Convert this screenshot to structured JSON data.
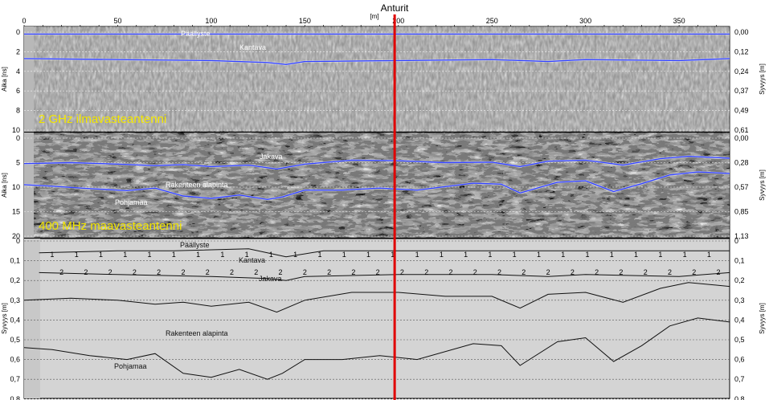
{
  "chart_data": {
    "type": "line",
    "title": "Anturit",
    "x": {
      "unit_label": "[m]",
      "range": [
        0,
        377
      ],
      "ticks": [
        0,
        50,
        100,
        150,
        200,
        250,
        300,
        350
      ],
      "marker": 198
    },
    "panels": [
      {
        "id": "ghz",
        "label": "2 GHz ilmavasteantenni",
        "left_axis": {
          "label": "Aika [ns]",
          "range": [
            0,
            10
          ],
          "ticks": [
            0,
            2,
            4,
            6,
            8,
            10
          ]
        },
        "right_axis": {
          "label": "Syvyys [m]",
          "ticks": [
            {
              "pos": 0,
              "text": "0,00"
            },
            {
              "pos": 2,
              "text": "0,12"
            },
            {
              "pos": 4,
              "text": "0,24"
            },
            {
              "pos": 6,
              "text": "0,37"
            },
            {
              "pos": 8,
              "text": "0,49"
            },
            {
              "pos": 10,
              "text": "0,61"
            }
          ]
        },
        "series": [
          {
            "name": "Päällyste",
            "x": [
              0,
              377
            ],
            "y": [
              0.2,
              0.2
            ]
          },
          {
            "name": "Kantava",
            "x": [
              0,
              50,
              100,
              130,
              140,
              150,
              200,
              250,
              280,
              300,
              350,
              377
            ],
            "y": [
              2.7,
              2.8,
              2.9,
              3.1,
              3.3,
              3.0,
              2.9,
              2.8,
              3.0,
              2.8,
              2.9,
              2.7
            ]
          }
        ]
      },
      {
        "id": "mhz",
        "label": "400 MHz maavasteantenni",
        "left_axis": {
          "label": "Aika [ns]",
          "range": [
            0,
            20
          ],
          "ticks": [
            0,
            5,
            10,
            15,
            20
          ]
        },
        "right_axis": {
          "label": "Syvyys [m]",
          "ticks": [
            {
              "pos": 0,
              "text": "0,00"
            },
            {
              "pos": 5,
              "text": "0,28"
            },
            {
              "pos": 10,
              "text": "0,57"
            },
            {
              "pos": 15,
              "text": "0,85"
            },
            {
              "pos": 20,
              "text": "1,13"
            }
          ]
        },
        "series": [
          {
            "name": "Jakava",
            "x": [
              0,
              25,
              50,
              70,
              85,
              100,
              120,
              135,
              150,
              175,
              200,
              225,
              250,
              265,
              280,
              300,
              320,
              340,
              355,
              377
            ],
            "y": [
              5.2,
              5.0,
              5.3,
              5.6,
              5.4,
              5.8,
              5.5,
              6.3,
              5.3,
              4.5,
              4.6,
              5.0,
              4.9,
              5.8,
              4.7,
              4.5,
              5.5,
              4.2,
              3.7,
              4.1
            ]
          },
          {
            "name": "Rakenteen alapinta",
            "x": [
              0,
              15,
              35,
              55,
              70,
              85,
              100,
              115,
              130,
              138,
              150,
              170,
              190,
              210,
              240,
              255,
              265,
              285,
              300,
              315,
              330,
              345,
              360,
              377
            ],
            "y": [
              9.5,
              9.8,
              10.3,
              10.7,
              10.2,
              11.8,
              12.3,
              11.6,
              12.5,
              12.0,
              10.6,
              10.6,
              10.2,
              10.6,
              9.2,
              9.4,
              11.2,
              9.0,
              8.7,
              10.9,
              9.3,
              7.5,
              6.9,
              7.2
            ]
          }
        ]
      },
      {
        "id": "interp",
        "left_axis": {
          "label": "Syvyys [m]",
          "range": [
            0,
            0.9
          ],
          "ticks": [
            "0",
            "0,1",
            "0,2",
            "0,3",
            "0,4",
            "0,5",
            "0,6",
            "0,7",
            "0,8"
          ]
        },
        "right_axis": {
          "label": "Syvyys [m]",
          "ticks": [
            "0",
            "0,1",
            "0,2",
            "0,3",
            "0,4",
            "0,5",
            "0,6",
            "0,7",
            "0,8"
          ]
        },
        "series": [
          {
            "name": "Päällyste",
            "x": [
              8,
              50,
              80,
              120,
              140,
              160,
              200,
              250,
              300,
              350,
              377
            ],
            "y": [
              0.06,
              0.05,
              0.05,
              0.04,
              0.08,
              0.05,
              0.05,
              0.05,
              0.05,
              0.05,
              0.05
            ]
          },
          {
            "name": "Kantava",
            "x": [
              8,
              50,
              100,
              130,
              140,
              150,
              200,
              250,
              280,
              300,
              350,
              377
            ],
            "y": [
              0.16,
              0.17,
              0.18,
              0.19,
              0.2,
              0.18,
              0.17,
              0.17,
              0.18,
              0.17,
              0.18,
              0.16
            ]
          },
          {
            "name": "Jakava",
            "x": [
              0,
              25,
              50,
              70,
              85,
              100,
              120,
              135,
              150,
              175,
              200,
              225,
              250,
              265,
              280,
              300,
              320,
              340,
              355,
              377
            ],
            "y": [
              0.3,
              0.29,
              0.3,
              0.32,
              0.31,
              0.33,
              0.31,
              0.36,
              0.3,
              0.26,
              0.26,
              0.28,
              0.28,
              0.34,
              0.27,
              0.26,
              0.31,
              0.24,
              0.21,
              0.23
            ]
          },
          {
            "name": "Rakenteen alapinta",
            "x": [
              0,
              15,
              35,
              55,
              70,
              85,
              100,
              115,
              130,
              138,
              150,
              170,
              190,
              210,
              240,
              255,
              265,
              285,
              300,
              315,
              330,
              345,
              360,
              377
            ],
            "y": [
              0.54,
              0.55,
              0.58,
              0.6,
              0.57,
              0.67,
              0.69,
              0.65,
              0.7,
              0.67,
              0.6,
              0.6,
              0.58,
              0.6,
              0.52,
              0.53,
              0.63,
              0.51,
              0.49,
              0.61,
              0.53,
              0.43,
              0.39,
              0.41
            ]
          }
        ],
        "annotations": [
          "Päällyste",
          "Kantava",
          "Jakava",
          "Rakenteen alapinta",
          "Pohjamaa"
        ],
        "marker_symbols": [
          "1",
          "2"
        ]
      }
    ],
    "overlay_labels": {
      "pohjamaa_mid": "Pohjamaa"
    },
    "colors": {
      "interface_line": "#3040ff",
      "marker_line": "#e00000",
      "label_yellow": "#f2e600",
      "panel_bg": "#d4d4d4"
    }
  }
}
